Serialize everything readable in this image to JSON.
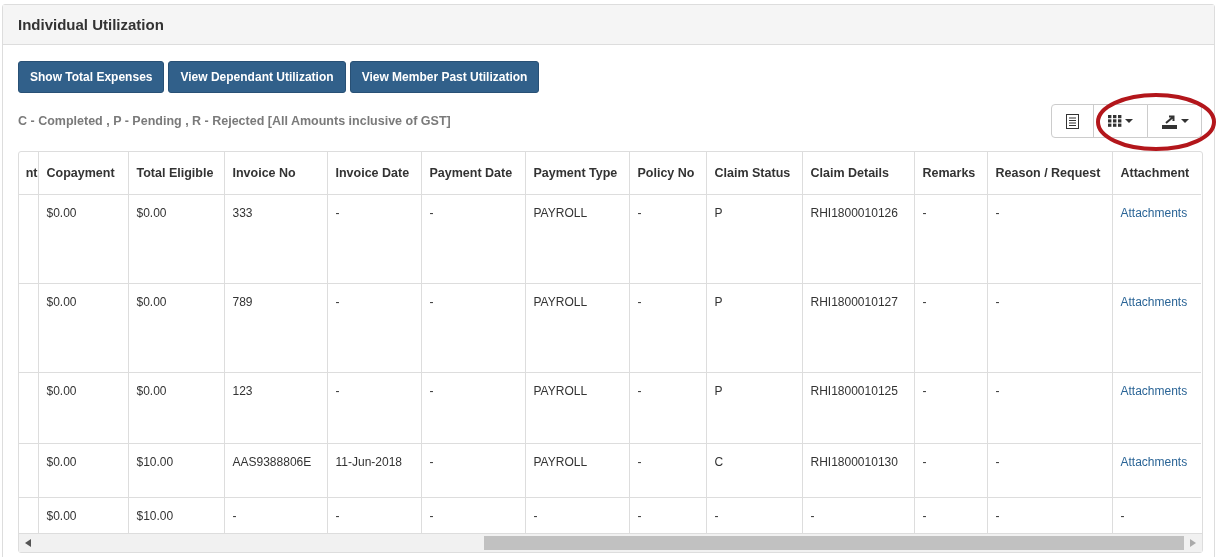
{
  "panel": {
    "title": "Individual Utilization"
  },
  "buttons": [
    "Show Total Expenses",
    "View Dependant Utilization",
    "View Member Past Utilization"
  ],
  "legend": "C - Completed , P - Pending , R - Rejected [All Amounts inclusive of GST]",
  "table": {
    "columns": [
      "nt",
      "Copayment",
      "Total Eligible",
      "Invoice No",
      "Invoice Date",
      "Payment Date",
      "Payment Type",
      "Policy No",
      "Claim Status",
      "Claim Details",
      "Remarks",
      "Reason / Request",
      "Attachment"
    ],
    "rows": [
      {
        "kind": "tall",
        "cells": [
          "",
          "$0.00",
          "$0.00",
          "333",
          "-",
          "-",
          "PAYROLL",
          "-",
          "P",
          "RHI1800010126",
          "-",
          "-"
        ],
        "attachment": {
          "text": "Attachments",
          "kind": "link"
        }
      },
      {
        "kind": "tall",
        "cells": [
          "",
          "$0.00",
          "$0.00",
          "789",
          "-",
          "-",
          "PAYROLL",
          "-",
          "P",
          "RHI1800010127",
          "-",
          "-"
        ],
        "attachment": {
          "text": "Attachments",
          "kind": "link"
        }
      },
      {
        "kind": "medium",
        "cells": [
          "",
          "$0.00",
          "$0.00",
          "123",
          "-",
          "-",
          "PAYROLL",
          "-",
          "P",
          "RHI1800010125",
          "-",
          "-"
        ],
        "attachment": {
          "text": "Attachments",
          "kind": "link"
        }
      },
      {
        "kind": "short",
        "cells": [
          "",
          "$0.00",
          "$10.00",
          "AAS9388806E",
          "11-Jun-2018",
          "-",
          "PAYROLL",
          "-",
          "C",
          "RHI1800010130",
          "-",
          "-"
        ],
        "attachment": {
          "text": "Attachments",
          "kind": "link"
        }
      },
      {
        "kind": "compact",
        "cells": [
          "",
          "$0.00",
          "$10.00",
          "-",
          "-",
          "-",
          "-",
          "-",
          "-",
          "-",
          "-",
          "-"
        ],
        "attachment": {
          "text": "-",
          "kind": "text"
        }
      }
    ]
  }
}
